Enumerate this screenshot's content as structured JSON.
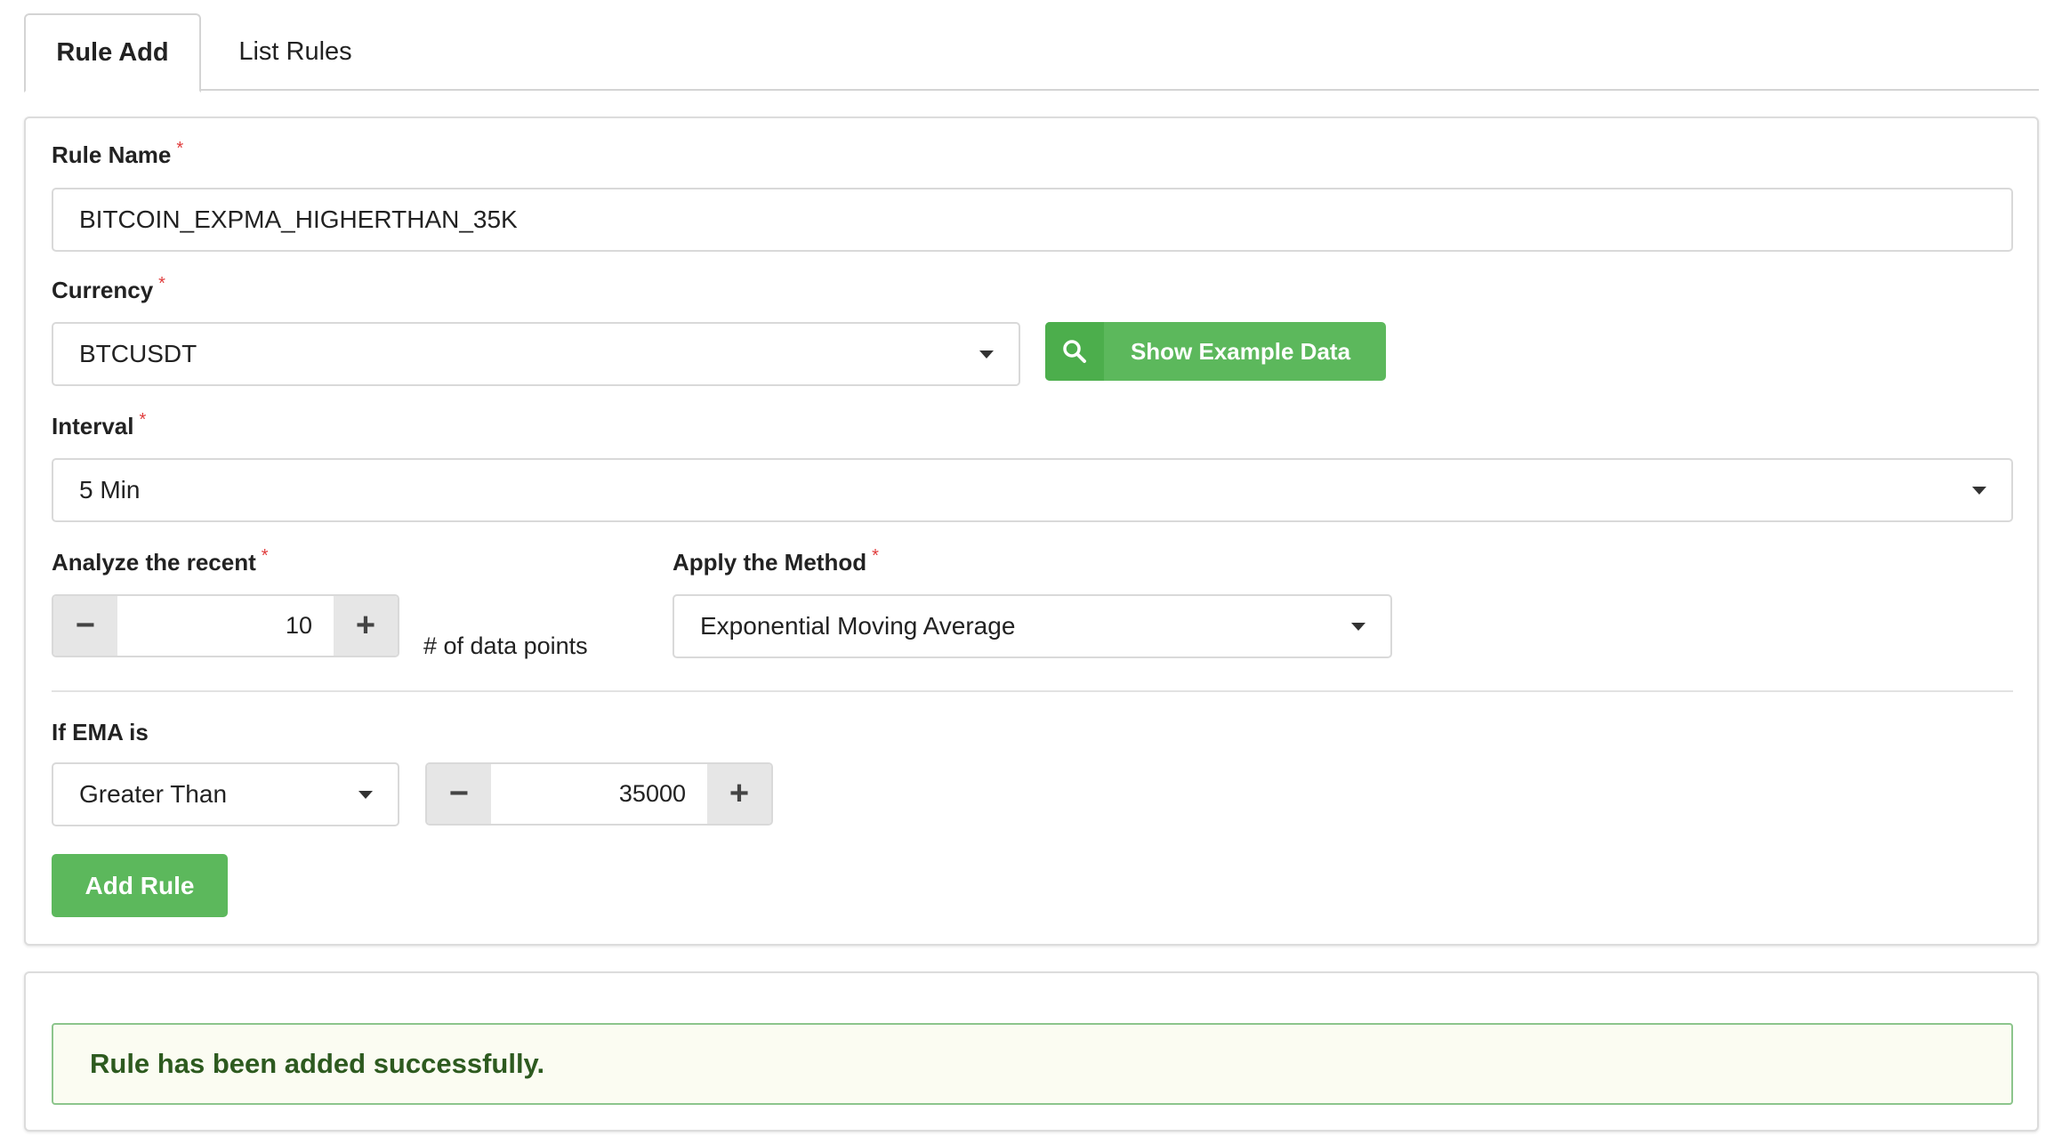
{
  "tabs": {
    "active": "Rule Add",
    "inactive": "List Rules"
  },
  "form": {
    "rule_name": {
      "label": "Rule Name",
      "required": "*",
      "value": "BITCOIN_EXPMA_HIGHERTHAN_35K"
    },
    "currency": {
      "label": "Currency",
      "required": "*",
      "value": "BTCUSDT"
    },
    "show_example_label": "Show Example Data",
    "interval": {
      "label": "Interval",
      "required": "*",
      "value": "5 Min"
    },
    "analyze": {
      "label": "Analyze the recent",
      "required": "*",
      "value": "10",
      "suffix": "# of data points",
      "minus": "−",
      "plus": "+"
    },
    "method": {
      "label": "Apply the Method",
      "required": "*",
      "value": "Exponential Moving Average"
    },
    "condition": {
      "label": "If EMA is",
      "comparator": "Greater Than",
      "value": "35000",
      "minus": "−",
      "plus": "+"
    },
    "add_rule_label": "Add Rule"
  },
  "message": {
    "text": "Rule has been added successfully."
  },
  "colors": {
    "accent_green": "#5cb85c",
    "required_red": "#e03c3c",
    "success_text": "#2d5a1f"
  },
  "icons": {
    "search": "search-icon",
    "caret": "caret-down-icon"
  }
}
